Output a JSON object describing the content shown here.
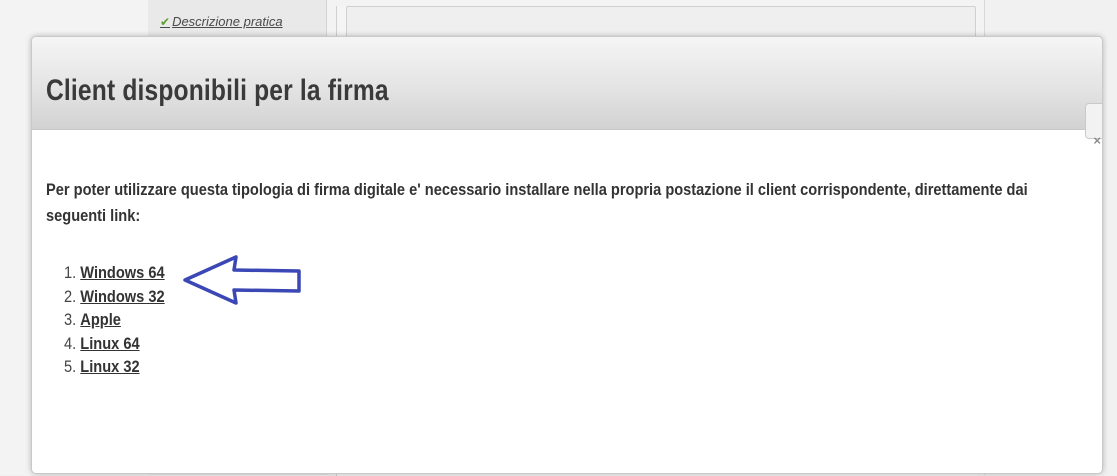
{
  "background": {
    "nav_item_label": "Descrizione pratica",
    "check_glyph": "✔"
  },
  "modal": {
    "title": "Client disponibili per la firma",
    "close_glyph": "×",
    "intro_text": "Per poter utilizzare questa tipologia di firma digitale e' necessario installare nella propria postazione il client corrispondente, direttamente dai seguenti link:",
    "links": [
      {
        "number": "1.",
        "label": "Windows 64"
      },
      {
        "number": "2.",
        "label": "Windows 32"
      },
      {
        "number": "3.",
        "label": "Apple"
      },
      {
        "number": "4.",
        "label": "Linux 64"
      },
      {
        "number": "5.",
        "label": "Linux 32"
      }
    ]
  },
  "annotation": {
    "icon": "left-arrow-icon",
    "stroke_color": "#3b47b5",
    "points_to": "Windows 64"
  }
}
